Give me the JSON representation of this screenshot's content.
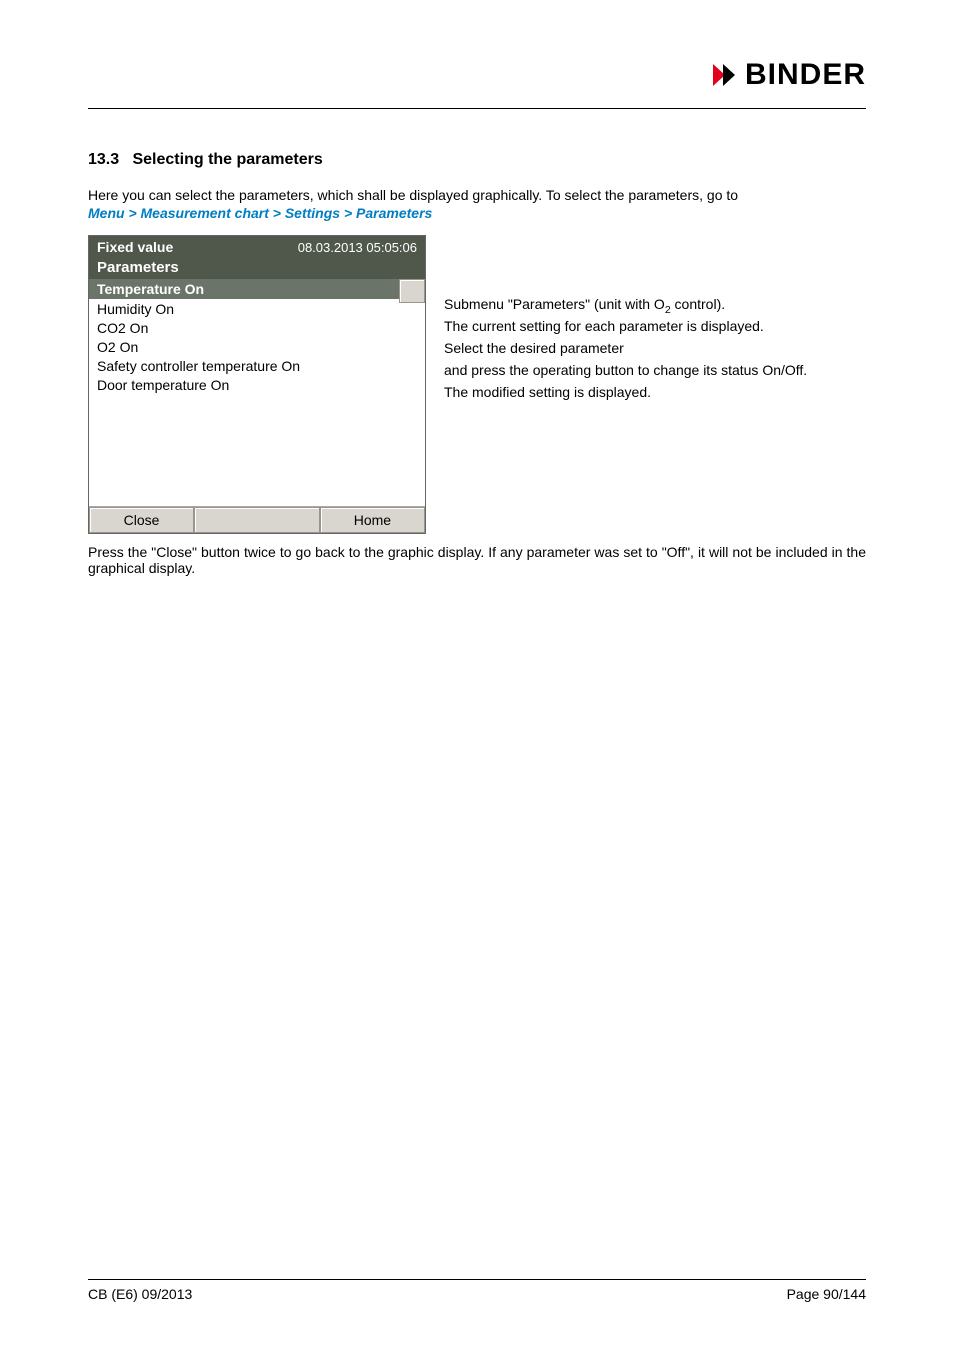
{
  "header": {
    "logo_text": "BINDER"
  },
  "section": {
    "number": "13.3",
    "title": "Selecting the parameters"
  },
  "intro": {
    "text": "Here you can select the parameters, which shall be displayed graphically. To select the parameters, go to",
    "menu_path": "Menu > Measurement chart > Settings > Parameters"
  },
  "panel": {
    "title": "Fixed value",
    "datetime": "08.03.2013  05:05:06",
    "subtitle": "Parameters",
    "items": [
      "Temperature On",
      "Humidity On",
      "CO2 On",
      "O2 On",
      "Safety controller temperature On",
      "Door temperature On"
    ],
    "buttons": {
      "close": "Close",
      "home": "Home"
    }
  },
  "description": {
    "l1a": "Submenu \"Parameters\" (unit with O",
    "l1b": " control).",
    "l2": "The current setting for each parameter is displayed.",
    "l3": "Select the desired parameter",
    "l4": "and press the operating button to change its status On/Off.",
    "l5": "The modified setting is displayed."
  },
  "closing": "Press the \"Close\" button twice to go back to the graphic display. If any parameter was set to \"Off\", it will not be included in the graphical display.",
  "footer": {
    "left": "CB (E6) 09/2013",
    "right": "Page 90/144"
  }
}
